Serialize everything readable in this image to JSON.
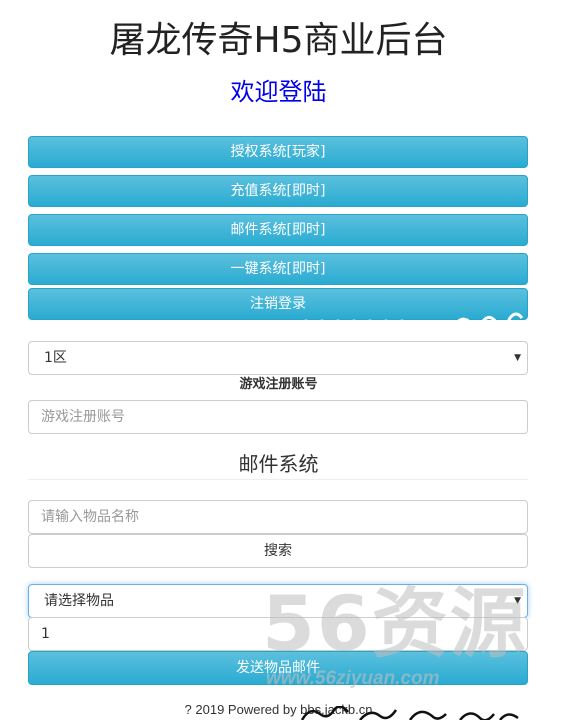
{
  "header": {
    "title": "屠龙传奇H5商业后台",
    "welcome": "欢迎登陆"
  },
  "nav_buttons": [
    {
      "label": "授权系统[玩家]"
    },
    {
      "label": "充值系统[即时]"
    },
    {
      "label": "邮件系统[即时]"
    },
    {
      "label": "一键系统[即时]"
    },
    {
      "label": "注销登录"
    }
  ],
  "server_select": {
    "value": "1区"
  },
  "account": {
    "label": "游戏注册账号",
    "placeholder": "游戏注册账号"
  },
  "mail_section": {
    "title": "邮件系统",
    "item_search_placeholder": "请输入物品名称",
    "search_label": "搜索",
    "item_select_value": "请选择物品",
    "quantity_value": "1",
    "send_label": "发送物品邮件"
  },
  "footer": {
    "text": "? 2019 Powered by bbs.jackb.cn"
  },
  "watermark": {
    "big": "56资源",
    "url": "www.56ziyuan.com"
  },
  "colors": {
    "accent_button": "#5bc0de",
    "welcome_link": "#0000ee"
  }
}
